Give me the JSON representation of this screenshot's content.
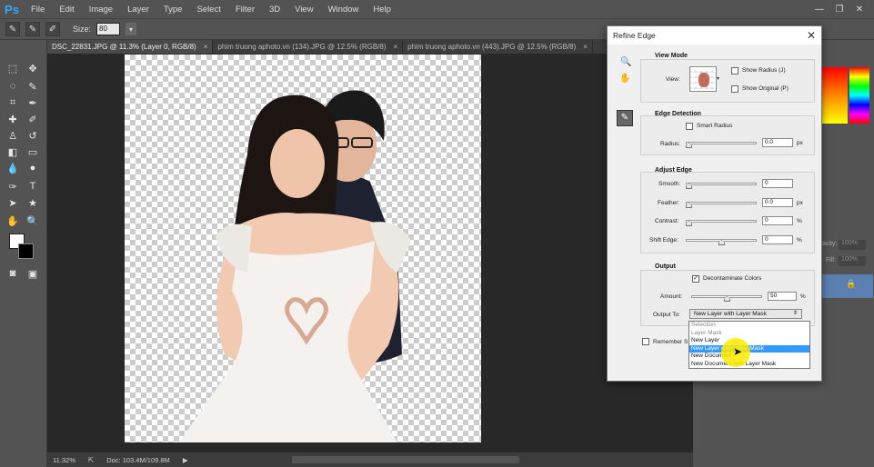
{
  "app": {
    "logo": "Ps"
  },
  "menu": [
    "File",
    "Edit",
    "Image",
    "Layer",
    "Type",
    "Select",
    "Filter",
    "3D",
    "View",
    "Window",
    "Help"
  ],
  "window_controls": {
    "minimize": "—",
    "restore": "❐",
    "close": "✕"
  },
  "options_bar": {
    "size_label": "Size:",
    "size_value": "80"
  },
  "tabs": [
    {
      "label": "DSC_22831.JPG @ 11.3% (Layer 0, RGB/8)",
      "active": true
    },
    {
      "label": "phim truong aphoto.vn (134).JPG @ 12.5% (RGB/8)",
      "active": false
    },
    {
      "label": "phim truong aphoto.vn (443).JPG @ 12.5% (RGB/8)",
      "active": false
    }
  ],
  "status": {
    "zoom": "11.32%",
    "doc": "Doc: 103.4M/109.8M"
  },
  "right_panel": {
    "opacity_label": "acity:",
    "opacity_value": "100%",
    "fill_label": "Fill:",
    "fill_value": "100%"
  },
  "dialog": {
    "title": "Refine Edge",
    "view_mode": {
      "title": "View Mode",
      "view_label": "View:",
      "show_radius": "Show Radius (J)",
      "show_original": "Show Original (P)"
    },
    "edge_detection": {
      "title": "Edge Detection",
      "smart_radius": "Smart Radius",
      "radius_label": "Radius:",
      "radius_value": "0.0",
      "radius_unit": "px"
    },
    "adjust_edge": {
      "title": "Adjust Edge",
      "smooth_label": "Smooth:",
      "smooth_value": "0",
      "feather_label": "Feather:",
      "feather_value": "0.0",
      "feather_unit": "px",
      "contrast_label": "Contrast:",
      "contrast_value": "0",
      "contrast_unit": "%",
      "shift_label": "Shift Edge:",
      "shift_value": "0",
      "shift_unit": "%"
    },
    "output": {
      "title": "Output",
      "decontaminate": "Decontaminate Colors",
      "amount_label": "Amount:",
      "amount_value": "50",
      "amount_unit": "%",
      "output_to_label": "Output To:",
      "output_to_value": "New Layer with Layer Mask",
      "remember": "Remember S"
    },
    "output_options": [
      {
        "label": "Selection",
        "state": "dim"
      },
      {
        "label": "Layer Mask",
        "state": "dim"
      },
      {
        "label": "New Layer",
        "state": "normal"
      },
      {
        "label": "New Layer with Layer Mask",
        "state": "selected"
      },
      {
        "label": "New Document",
        "state": "normal"
      },
      {
        "label": "New Document with Layer Mask",
        "state": "normal"
      }
    ]
  },
  "colors": {
    "ui_dark": "#535353",
    "canvas_bg": "#282828",
    "highlight": "#3399ff",
    "annotation_red": "#e02020",
    "cursor_yellow": "#ffeb00"
  }
}
